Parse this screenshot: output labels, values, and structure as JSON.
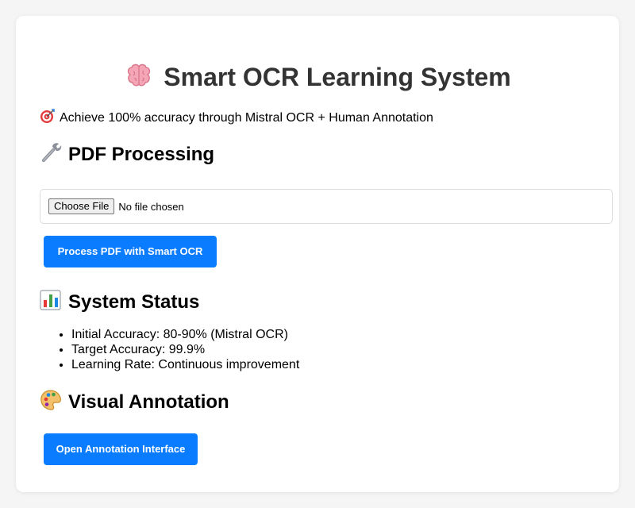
{
  "header": {
    "title": "Smart OCR Learning System",
    "title_icon": "brain-icon",
    "subtitle": "Achieve 100% accuracy through Mistral OCR + Human Annotation",
    "subtitle_icon": "target-icon"
  },
  "pdf_section": {
    "heading": "PDF Processing",
    "icon": "wrench-icon",
    "file_input": {
      "button_label": "Choose File",
      "status": "No file chosen"
    },
    "process_button_label": "Process PDF with Smart OCR"
  },
  "status_section": {
    "heading": "System Status",
    "icon": "bar-chart-icon",
    "items": [
      "Initial Accuracy: 80-90% (Mistral OCR)",
      "Target Accuracy: 99.9%",
      "Learning Rate: Continuous improvement"
    ]
  },
  "annotation_section": {
    "heading": "Visual Annotation",
    "icon": "palette-icon",
    "open_button_label": "Open Annotation Interface"
  },
  "colors": {
    "accent": "#0a7cff",
    "title_text": "#333333",
    "background": "#f5f5f5",
    "card": "#ffffff"
  }
}
